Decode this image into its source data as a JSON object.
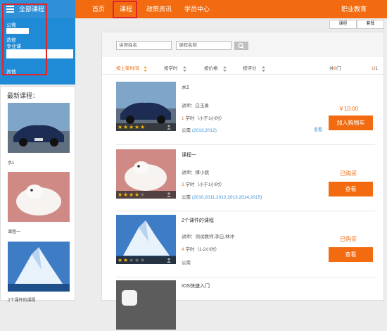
{
  "header": {
    "all_courses": "全部课程",
    "nav": [
      "首页",
      "课程",
      "政策资讯",
      "学员中心"
    ],
    "right_title": "职业教育"
  },
  "categories": [
    "公需",
    "选修",
    "专业课",
    "其他"
  ],
  "view_tabs": [
    "课程",
    "套餐"
  ],
  "sidebar": {
    "title": "最新课程：",
    "items": [
      "水1",
      "课程一",
      "2个课件的课程"
    ]
  },
  "search": {
    "teacher_placeholder": "讲师姓名",
    "course_placeholder": "课程名称"
  },
  "sort": {
    "items": [
      "按上架时间",
      "按学时",
      "按价格",
      "按评分"
    ],
    "total_prefix": "共",
    "total_count": "9",
    "total_suffix": "门",
    "page_current": "1",
    "page_total": "/1"
  },
  "courses": [
    {
      "title": "水1",
      "teacher": "讲师：白玉勇",
      "hours_num": "1",
      "hours_text": "学时（小于1小时）",
      "type": "公需",
      "years": "(2013,2012)",
      "price": "￥10.00",
      "look": "查看",
      "button": "加入购物车",
      "rating": 5
    },
    {
      "title": "课程一",
      "teacher": "讲师：撑小跳",
      "hours_num": "3",
      "hours_text": "学时（小于1小时）",
      "type": "公需",
      "years": "(2010,2011,2012,2013,2014,2015)",
      "bought": "已购买",
      "button": "查看",
      "rating": 4
    },
    {
      "title": "2个课件的课程",
      "teacher": "讲师：测试教师,李白,林冲",
      "hours_num": "4",
      "hours_text": "学时（1-2小时）",
      "type": "公需",
      "years": "",
      "bought": "已购买",
      "button": "查看",
      "rating": 2
    },
    {
      "title": "IOS快速入门",
      "teacher": "",
      "hours_num": "",
      "hours_text": "",
      "type": "",
      "years": "",
      "button": ""
    }
  ],
  "colors": {
    "accent": "#f26b10",
    "blue": "#2f8fd7",
    "highlight": "#e0262a"
  }
}
